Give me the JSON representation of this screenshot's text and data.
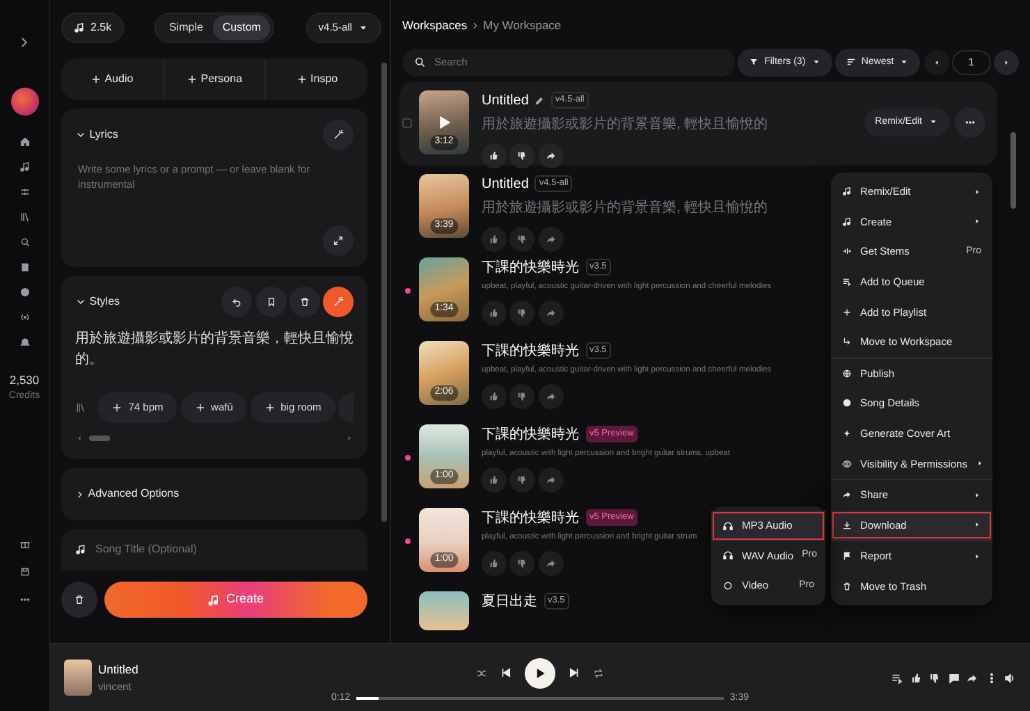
{
  "rail": {
    "credits": "2,530",
    "credits_label": "Credits"
  },
  "top": {
    "credits_chip": "2.5k",
    "modes": [
      {
        "label": "Simple",
        "selected": false
      },
      {
        "label": "Custom",
        "selected": true
      }
    ],
    "model": "v4.5-all"
  },
  "add_buttons": [
    "Audio",
    "Persona",
    "Inspo"
  ],
  "lyrics": {
    "title": "Lyrics",
    "expanded": true,
    "placeholder": "Write some lyrics or a prompt — or leave blank for instrumental"
  },
  "styles": {
    "title": "Styles",
    "expanded": true,
    "value": "用於旅遊攝影或影片的背景音樂，輕快且愉悅的。",
    "tags": [
      "74 bpm",
      "wafū",
      "big room"
    ]
  },
  "advanced": {
    "title": "Advanced Options",
    "expanded": false
  },
  "song_title": {
    "placeholder": "Song Title (Optional)"
  },
  "create_button": "Create",
  "breadcrumb": [
    "Workspaces",
    "My Workspace"
  ],
  "search": {
    "placeholder": "Search"
  },
  "filters": "Filters (3)",
  "sort": "Newest",
  "page": "1",
  "songs": [
    {
      "title": "Untitled",
      "version": "v4.5-all",
      "preview": false,
      "description": "用於旅遊攝影或影片的背景音樂, 輕快且愉悅的",
      "duration": "3:12",
      "hovered": true,
      "new": false
    },
    {
      "title": "Untitled",
      "version": "v4.5-all",
      "preview": false,
      "description": "用於旅遊攝影或影片的背景音樂, 輕快且愉悅的",
      "duration": "3:39",
      "hovered": false,
      "new": false
    },
    {
      "title": "下課的快樂時光",
      "version": "v3.5",
      "preview": false,
      "description": "upbeat, playful, acoustic guitar-driven with light percussion and cheerful melodies",
      "duration": "1:34",
      "hovered": false,
      "new": true
    },
    {
      "title": "下課的快樂時光",
      "version": "v3.5",
      "preview": false,
      "description": "upbeat, playful, acoustic guitar-driven with light percussion and cheerful melodies",
      "duration": "2:06",
      "hovered": false,
      "new": false
    },
    {
      "title": "下課的快樂時光",
      "version": "v5 Preview",
      "preview": true,
      "description": "playful, acoustic with light percussion and bright guitar strums, upbeat",
      "duration": "1:00",
      "hovered": false,
      "new": true
    },
    {
      "title": "下課的快樂時光",
      "version": "v5 Preview",
      "preview": true,
      "description": "playful, acoustic with light percussion and bright guitar strum",
      "duration": "1:00",
      "hovered": false,
      "new": true
    },
    {
      "title": "夏日出走",
      "version": "v3.5",
      "preview": false,
      "hovered": false,
      "new": false
    }
  ],
  "remix_button": "Remix/Edit",
  "menu": [
    [
      {
        "label": "Remix/Edit",
        "submenu": true,
        "highlighted": false
      },
      {
        "label": "Create",
        "submenu": true,
        "highlighted": false
      },
      {
        "label": "Get Stems",
        "badge": "Pro",
        "submenu": false,
        "highlighted": false
      },
      {
        "label": "Add to Queue",
        "submenu": false,
        "highlighted": false
      },
      {
        "label": "Add to Playlist",
        "submenu": false,
        "highlighted": false
      },
      {
        "label": "Move to Workspace",
        "submenu": false,
        "highlighted": false
      }
    ],
    [
      {
        "label": "Publish",
        "submenu": false,
        "highlighted": false
      },
      {
        "label": "Song Details",
        "submenu": false,
        "highlighted": false
      },
      {
        "label": "Generate Cover Art",
        "submenu": false,
        "highlighted": false
      },
      {
        "label": "Visibility & Permissions",
        "submenu": true,
        "highlighted": false
      }
    ],
    [
      {
        "label": "Share",
        "submenu": true,
        "highlighted": false
      },
      {
        "label": "Download",
        "submenu": true,
        "highlighted": true
      }
    ],
    [
      {
        "label": "Report",
        "submenu": true,
        "highlighted": false
      },
      {
        "label": "Move to Trash",
        "submenu": false,
        "highlighted": false
      }
    ]
  ],
  "submenu": [
    {
      "label": "MP3 Audio",
      "highlighted": true
    },
    {
      "label": "WAV Audio",
      "badge": "Pro",
      "highlighted": false
    },
    {
      "label": "Video",
      "badge": "Pro",
      "highlighted": false
    }
  ],
  "player": {
    "title": "Untitled",
    "artist": "vincent",
    "elapsed": "0:12",
    "total": "3:39",
    "level": 0.06
  }
}
